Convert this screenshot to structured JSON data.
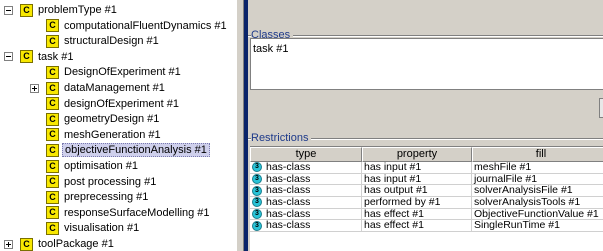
{
  "colors": {
    "class_badge": "#f8e800",
    "selection": "#cfd0ec",
    "panel": "#d4d0c8",
    "accent_edge": "#0a246a",
    "group_title": "#1e3a8a",
    "restriction_icon": "#28c4d8"
  },
  "tree": {
    "badge_letter": "C",
    "nodes": [
      {
        "label": "problemType #1",
        "toggle": "minus",
        "level": 0
      },
      {
        "label": "computationalFluentDynamics #1",
        "level": 1
      },
      {
        "label": "structuralDesign #1",
        "level": 1
      },
      {
        "label": "task #1",
        "toggle": "minus",
        "level": 0
      },
      {
        "label": "DesignOfExperiment #1",
        "level": 1
      },
      {
        "label": "dataManagement #1",
        "toggle": "plus",
        "level": 1
      },
      {
        "label": "designOfExperiment #1",
        "level": 1
      },
      {
        "label": "geometryDesign #1",
        "level": 1
      },
      {
        "label": "meshGeneration #1",
        "level": 1
      },
      {
        "label": "objectiveFunctionAnalysis #1",
        "level": 1,
        "selected": true
      },
      {
        "label": "optimisation #1",
        "level": 1
      },
      {
        "label": "post processing #1",
        "level": 1
      },
      {
        "label": "preprecessing #1",
        "level": 1
      },
      {
        "label": "responseSurfaceModelling #1",
        "level": 1
      },
      {
        "label": "visualisation #1",
        "level": 1
      },
      {
        "label": "toolPackage #1",
        "toggle": "plus",
        "level": 0
      }
    ]
  },
  "classes": {
    "title": "Classes",
    "value": "task #1"
  },
  "restrictions": {
    "title": "Restrictions",
    "icon_letter": "3",
    "columns": [
      "type",
      "property",
      "fill"
    ],
    "rows": [
      [
        "has-class",
        "has input #1",
        "meshFile #1"
      ],
      [
        "has-class",
        "has input #1",
        "journalFile #1"
      ],
      [
        "has-class",
        "has output #1",
        "solverAnalysisFile #1"
      ],
      [
        "has-class",
        "performed by #1",
        "solverAnalysisTools #1"
      ],
      [
        "has-class",
        "has effect #1",
        "ObjectiveFunctionValue #1"
      ],
      [
        "has-class",
        "has effect #1",
        "SingleRunTime #1"
      ]
    ]
  }
}
